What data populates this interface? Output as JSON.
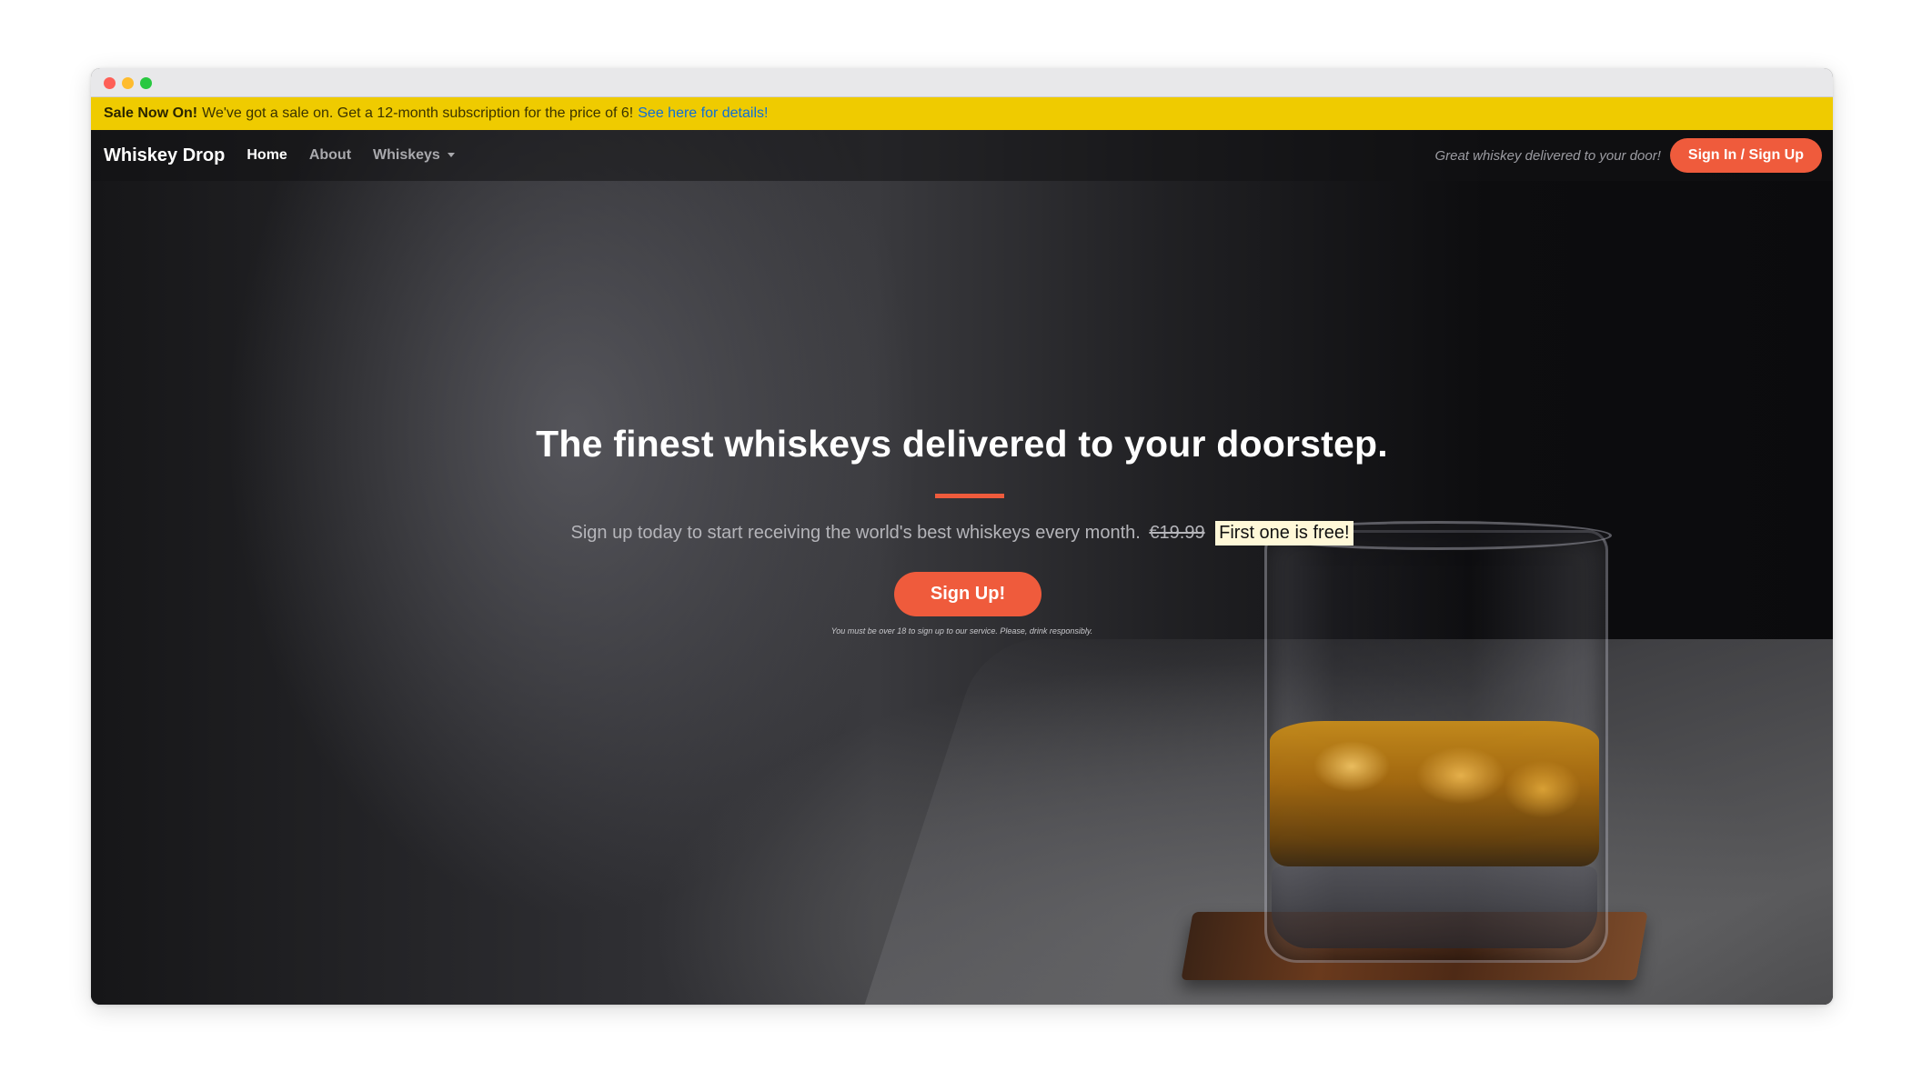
{
  "sale_bar": {
    "strong": "Sale Now On!",
    "text": "We've got a sale on. Get a 12-month subscription for the price of 6!",
    "link": "See here for details!"
  },
  "nav": {
    "brand": "Whiskey Drop",
    "links": [
      {
        "label": "Home",
        "active": true
      },
      {
        "label": "About",
        "active": false
      },
      {
        "label": "Whiskeys",
        "active": false,
        "dropdown": true
      }
    ],
    "tagline": "Great whiskey delivered to your door!",
    "signin_label": "Sign In / Sign Up"
  },
  "hero": {
    "headline": "The finest whiskeys delivered to your doorstep.",
    "subline": "Sign up today to start receiving the world's best whiskeys every month.",
    "old_price": "€19.99",
    "free_badge": "First one is free!",
    "cta_label": "Sign Up!",
    "disclaimer": "You must be over 18 to sign up to our service. Please, drink responsibly."
  },
  "colors": {
    "accent": "#ef5b3c",
    "sale_bar": "#efcb00",
    "link": "#0d6fd8"
  },
  "icons": [
    "window-close-icon",
    "window-minimize-icon",
    "window-maximize-icon",
    "caret-down-icon"
  ]
}
